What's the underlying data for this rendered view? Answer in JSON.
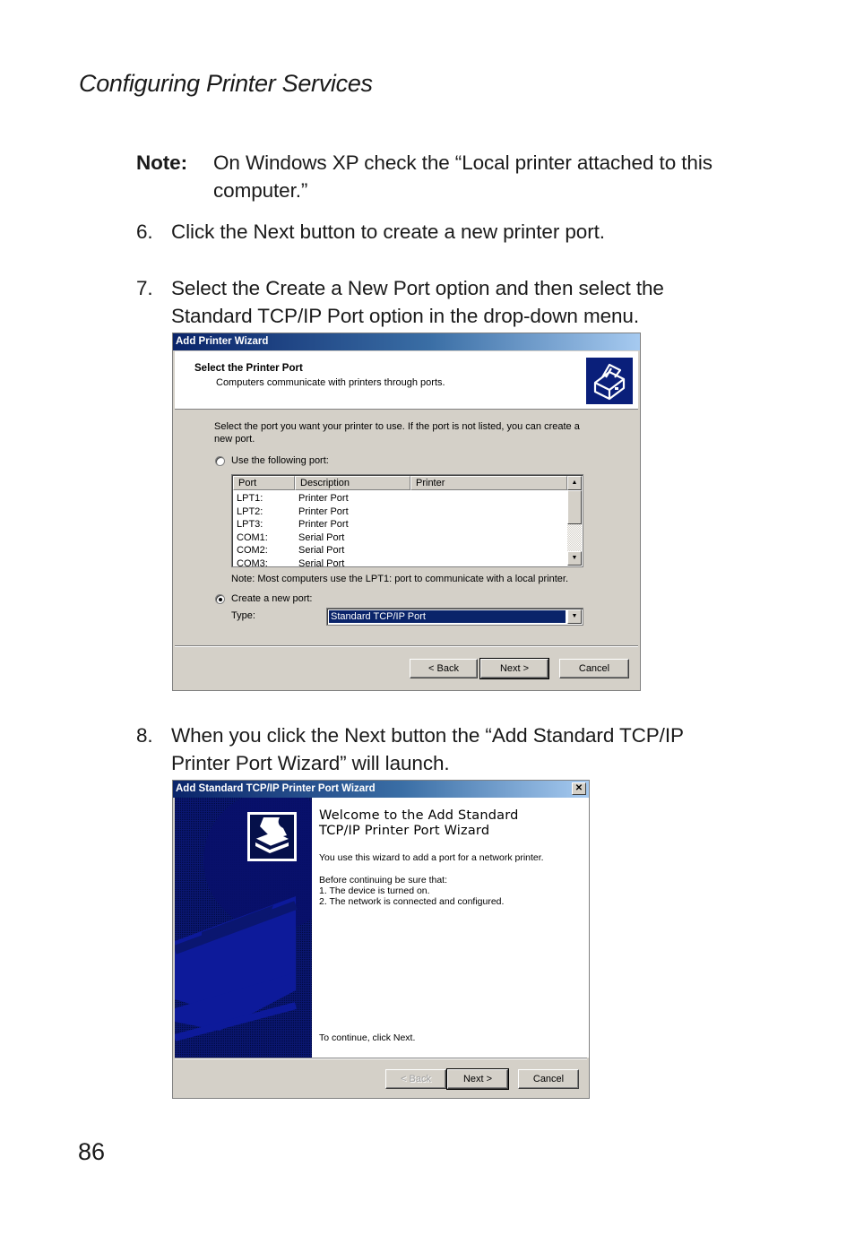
{
  "page": {
    "running_head": "Configuring Printer Services",
    "page_number": "86",
    "note": {
      "label": "Note:",
      "text": "On Windows XP check the “Local printer attached to this computer.”"
    },
    "steps": [
      {
        "num": "6.",
        "text": "Click the Next button to create a new printer port."
      },
      {
        "num": "7.",
        "text": "Select the Create a New Port option and then select the Standard TCP/IP Port option in the drop-down menu."
      },
      {
        "num": "8.",
        "text": "When you click the Next button the “Add Standard TCP/IP Printer Port Wizard” will launch."
      }
    ]
  },
  "dialog1": {
    "title": "Add Printer Wizard",
    "header_title": "Select the Printer Port",
    "header_subtitle": "Computers communicate with printers through ports.",
    "header_icon": "printer-icon",
    "instruction": "Select the port you want your printer to use.  If the port is not listed, you can create a new port.",
    "radio_use_existing": {
      "label": "Use the following port:",
      "checked": false
    },
    "port_list": {
      "columns": [
        "Port",
        "Description",
        "Printer"
      ],
      "rows": [
        {
          "port": "LPT1:",
          "description": "Printer Port",
          "printer": ""
        },
        {
          "port": "LPT2:",
          "description": "Printer Port",
          "printer": ""
        },
        {
          "port": "LPT3:",
          "description": "Printer Port",
          "printer": ""
        },
        {
          "port": "COM1:",
          "description": "Serial Port",
          "printer": ""
        },
        {
          "port": "COM2:",
          "description": "Serial Port",
          "printer": ""
        },
        {
          "port": "COM3:",
          "description": "Serial Port",
          "printer": ""
        }
      ]
    },
    "note": "Note: Most computers use the LPT1: port to communicate with a local printer.",
    "radio_create_new": {
      "label": "Create a new port:",
      "checked": true
    },
    "type_label": "Type:",
    "type_value": "Standard TCP/IP Port",
    "buttons": {
      "back": "< Back",
      "next": "Next >",
      "cancel": "Cancel"
    }
  },
  "dialog2": {
    "title": "Add Standard TCP/IP Printer Port Wizard",
    "close_icon": "close-icon",
    "welcome_title_line1": "Welcome to the Add Standard",
    "welcome_title_line2": "TCP/IP Printer Port Wizard",
    "intro": "You use this wizard to add a port for a network printer.",
    "before": "Before continuing be sure that:",
    "checklist": [
      "1.  The device is turned on.",
      "2.  The network is connected and configured."
    ],
    "continue_text": "To continue, click Next.",
    "buttons": {
      "back": "< Back",
      "next": "Next >",
      "cancel": "Cancel"
    },
    "back_disabled": true
  }
}
